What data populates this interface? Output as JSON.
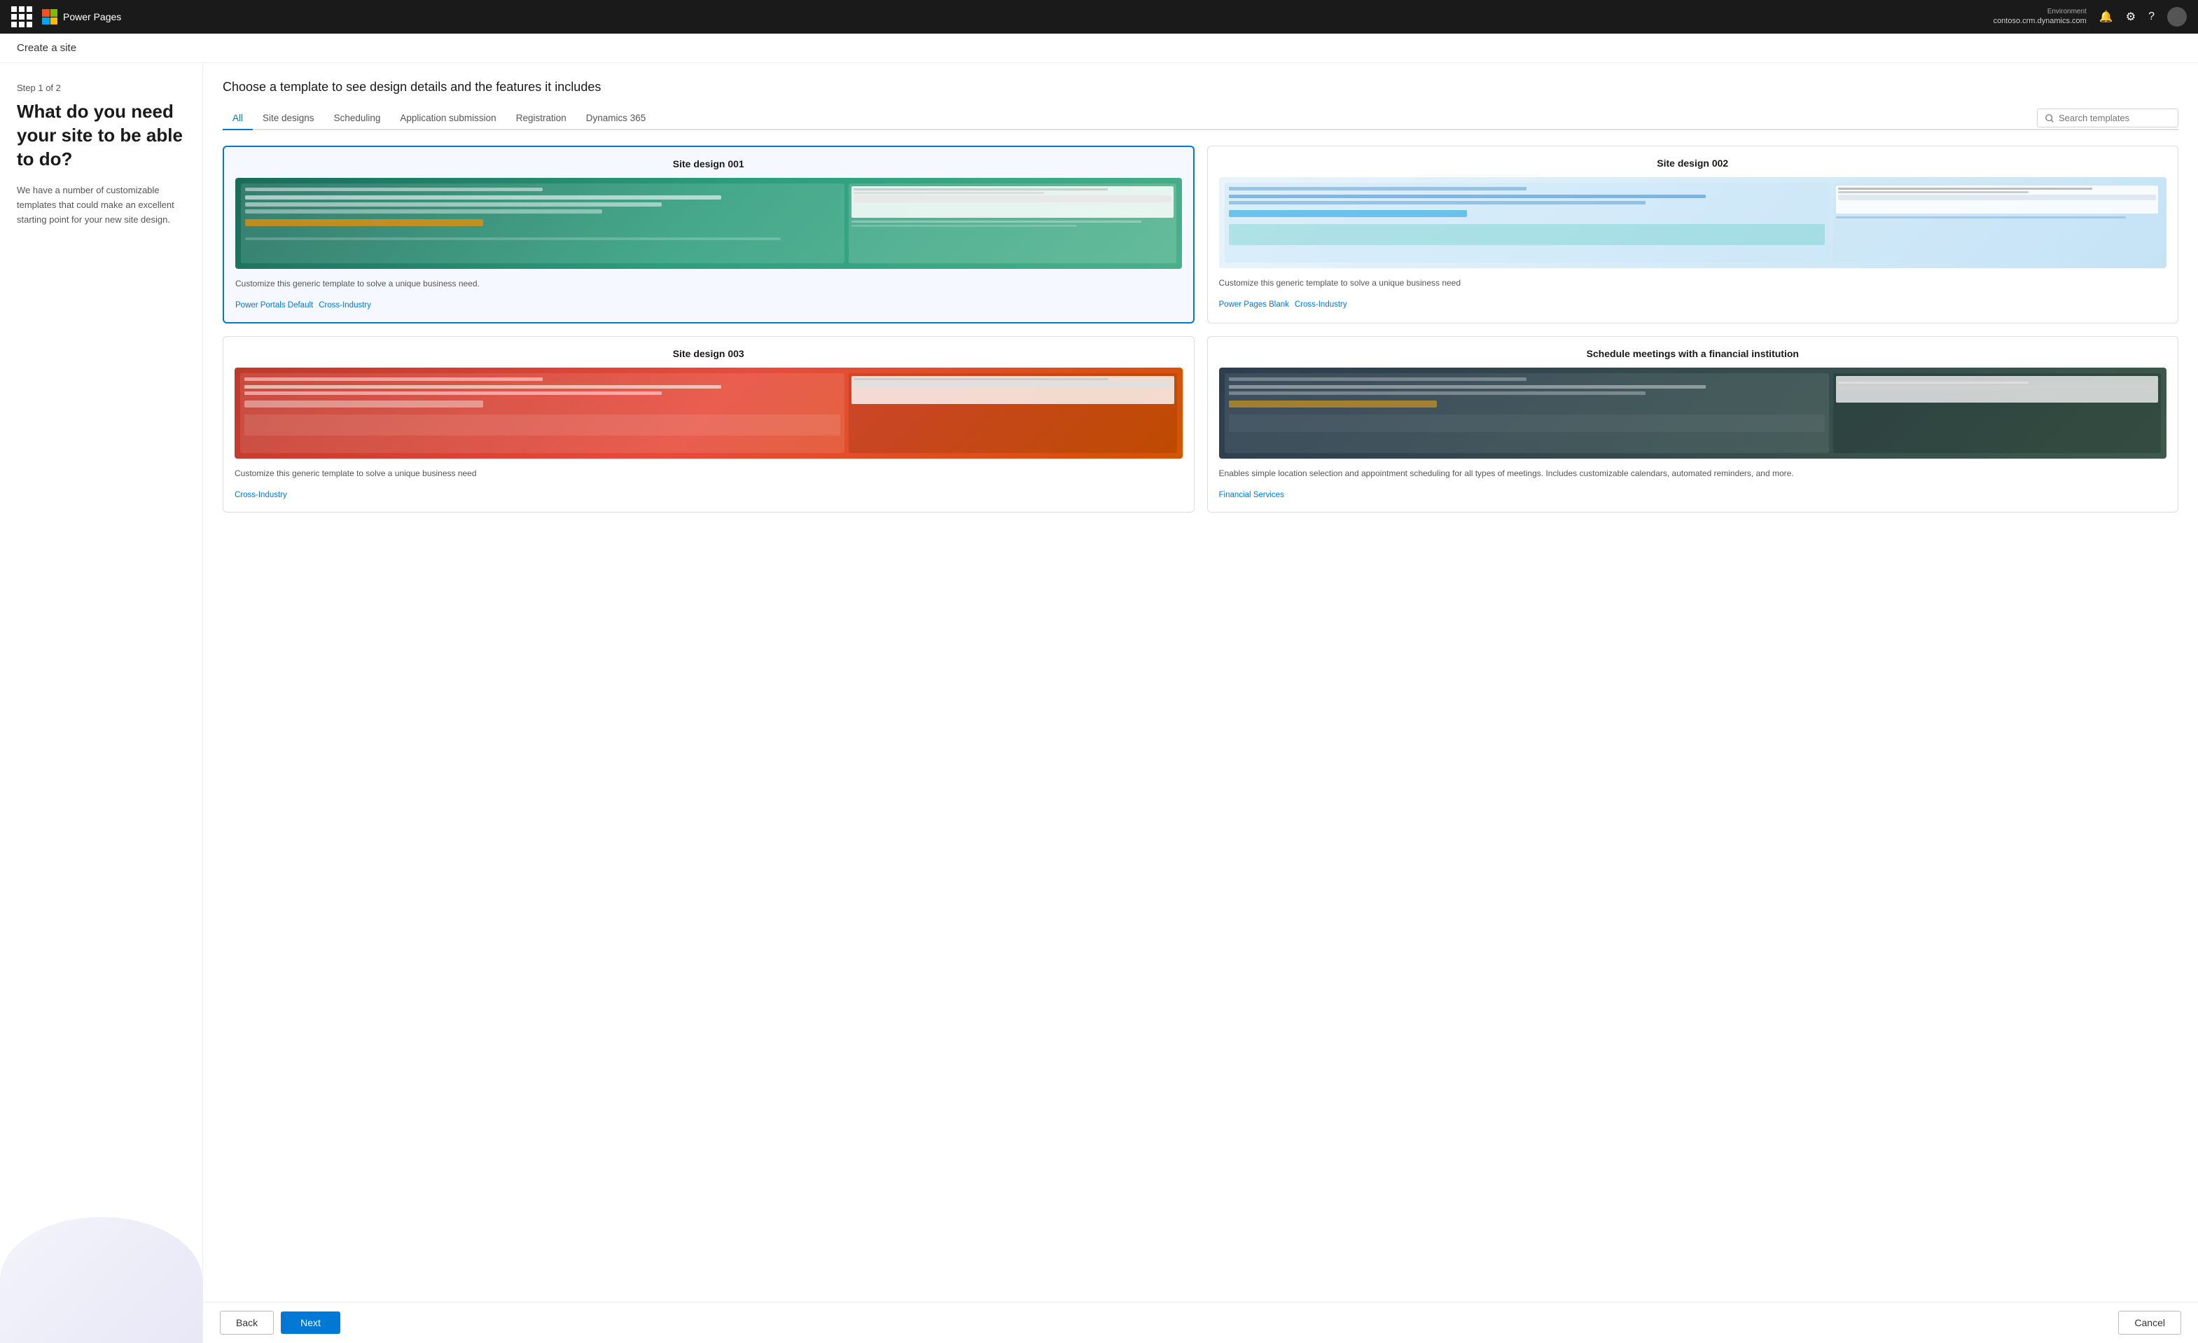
{
  "topnav": {
    "app_name": "Power Pages",
    "env_label": "Environment",
    "env_value": "contoso.crm.dynamics.com",
    "icons": {
      "waffle": "⊞",
      "bell": "🔔",
      "settings": "⚙",
      "help": "?"
    }
  },
  "page": {
    "title": "Create a site"
  },
  "sidebar": {
    "step_label": "Step 1 of 2",
    "heading": "What do you need your site to be able to do?",
    "description": "We have a number of customizable templates that could make an excellent starting point for your new site design."
  },
  "content": {
    "heading": "Choose a template to see design details and the features it includes",
    "tabs": [
      {
        "id": "all",
        "label": "All",
        "active": true
      },
      {
        "id": "site-designs",
        "label": "Site designs"
      },
      {
        "id": "scheduling",
        "label": "Scheduling"
      },
      {
        "id": "application-submission",
        "label": "Application submission"
      },
      {
        "id": "registration",
        "label": "Registration"
      },
      {
        "id": "dynamics-365",
        "label": "Dynamics 365"
      }
    ],
    "search_placeholder": "Search templates",
    "templates": [
      {
        "id": "site-001",
        "title": "Site design 001",
        "description": "Customize this generic template to solve a unique business need.",
        "tags": [
          "Power Portals Default",
          "Cross-Industry"
        ],
        "selected": true
      },
      {
        "id": "site-002",
        "title": "Site design 002",
        "description": "Customize this generic template to solve a unique business need",
        "tags": [
          "Power Pages Blank",
          "Cross-Industry"
        ],
        "selected": false
      },
      {
        "id": "site-003",
        "title": "Site design 003",
        "description": "Customize this generic template to solve a unique business need",
        "tags": [
          "Cross-Industry"
        ],
        "selected": false
      },
      {
        "id": "schedule-meetings",
        "title": "Schedule meetings with a financial institution",
        "description": "Enables simple location selection and appointment scheduling for all types of meetings. Includes customizable calendars, automated reminders, and more.",
        "tags": [
          "Financial Services"
        ],
        "selected": false
      }
    ]
  },
  "footer": {
    "back_label": "Back",
    "next_label": "Next",
    "cancel_label": "Cancel"
  }
}
